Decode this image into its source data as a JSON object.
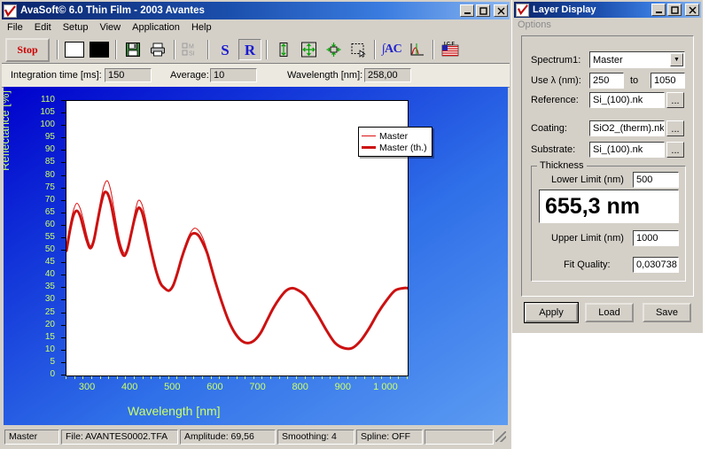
{
  "main_window": {
    "title": "AvaSoft© 6.0 Thin Film - 2003 Avantes",
    "icon": "avasoft-checkmark-icon",
    "buttons": {
      "minimize": "_",
      "maximize": "□",
      "close": "✕"
    },
    "menu": [
      "File",
      "Edit",
      "Setup",
      "View",
      "Application",
      "Help"
    ],
    "toolbar": {
      "stop_label": "Stop",
      "items": [
        {
          "name": "white-reference-button",
          "glyph": ""
        },
        {
          "name": "dark-reference-button",
          "glyph": ""
        },
        {
          "name": "save-button",
          "glyph": ""
        },
        {
          "name": "print-button",
          "glyph": ""
        },
        {
          "name": "multi-si-button",
          "glyph": "M\nSI"
        },
        {
          "name": "scope-s-button",
          "glyph": "S"
        },
        {
          "name": "reflectance-r-button",
          "glyph": "R"
        },
        {
          "name": "scale-vertical-button",
          "glyph": ""
        },
        {
          "name": "zoom-fit-button",
          "glyph": ""
        },
        {
          "name": "zoom-out-button",
          "glyph": ""
        },
        {
          "name": "select-region-button",
          "glyph": ""
        },
        {
          "name": "integrate-ac-button",
          "glyph": "∫AC"
        },
        {
          "name": "peak-graph-button",
          "glyph": ""
        },
        {
          "name": "icf-button",
          "glyph": "I.C.F"
        }
      ]
    },
    "params": {
      "integration_time_label": "Integration time [ms]:",
      "integration_time_value": "150",
      "average_label": "Average:",
      "average_value": "10",
      "wavelength_label": "Wavelength [nm]:",
      "wavelength_value": "258,00"
    },
    "statusbar": {
      "spectrum": "Master",
      "file": "File: AVANTES0002.TFA",
      "amplitude": "Amplitude: 69,56",
      "smoothing": "Smoothing: 4",
      "spline": "Spline: OFF",
      "empty": ""
    }
  },
  "chart_data": {
    "type": "line",
    "title": "",
    "xlabel": "Wavelength [nm]",
    "ylabel": "Reflectance [%]",
    "xlim": [
      250,
      1050
    ],
    "ylim": [
      0,
      110
    ],
    "xticks": [
      300,
      400,
      500,
      600,
      700,
      800,
      900,
      1000
    ],
    "xticklabels": [
      "300",
      "400",
      "500",
      "600",
      "700",
      "800",
      "900",
      "1 000"
    ],
    "yticks": [
      0,
      5,
      10,
      15,
      20,
      25,
      30,
      35,
      40,
      45,
      50,
      55,
      60,
      65,
      70,
      75,
      80,
      85,
      90,
      95,
      100,
      105,
      110
    ],
    "grid": false,
    "legend_position": "outside-right-top",
    "background": "#ffffff",
    "plot_frame_color": "#000000",
    "axis_text_color": "#ccff66",
    "series": [
      {
        "name": "Master",
        "color": "#dd1111",
        "linewidth": 1,
        "x": [
          250,
          258,
          266,
          274,
          282,
          290,
          298,
          306,
          314,
          322,
          330,
          338,
          346,
          354,
          362,
          370,
          378,
          386,
          394,
          402,
          410,
          418,
          426,
          434,
          442,
          450,
          460,
          470,
          480,
          490,
          500,
          510,
          520,
          530,
          540,
          550,
          560,
          570,
          580,
          590,
          600,
          615,
          630,
          645,
          660,
          675,
          690,
          705,
          720,
          735,
          750,
          765,
          780,
          795,
          810,
          825,
          840,
          860,
          880,
          900,
          920,
          940,
          960,
          980,
          1000,
          1020,
          1040,
          1050
        ],
        "y": [
          52,
          60,
          66,
          69,
          67,
          62,
          56,
          52,
          55,
          62,
          70,
          76,
          78,
          74,
          66,
          58,
          52,
          49,
          52,
          58,
          65,
          70,
          69,
          64,
          57,
          50,
          43,
          38,
          35,
          34,
          36,
          41,
          47,
          53,
          57,
          59,
          58,
          55,
          50,
          44,
          38,
          29,
          22,
          17,
          14,
          13,
          14,
          17,
          22,
          27,
          31,
          34,
          35,
          34,
          32,
          28,
          24,
          18,
          13,
          11,
          11,
          14,
          19,
          25,
          30,
          34,
          35,
          35
        ]
      },
      {
        "name": "Master (th.)",
        "color": "#cc1111",
        "linewidth": 3,
        "x": [
          250,
          258,
          266,
          274,
          282,
          290,
          298,
          306,
          314,
          322,
          330,
          338,
          346,
          354,
          362,
          370,
          378,
          386,
          394,
          402,
          410,
          418,
          426,
          434,
          442,
          450,
          460,
          470,
          480,
          490,
          500,
          510,
          520,
          530,
          540,
          550,
          560,
          570,
          580,
          590,
          600,
          615,
          630,
          645,
          660,
          675,
          690,
          705,
          720,
          735,
          750,
          765,
          780,
          795,
          810,
          825,
          840,
          860,
          880,
          900,
          920,
          940,
          960,
          980,
          1000,
          1020,
          1040,
          1050
        ],
        "y": [
          50,
          58,
          64,
          66,
          64,
          59,
          54,
          51,
          54,
          61,
          68,
          73,
          73,
          69,
          62,
          55,
          50,
          48,
          51,
          57,
          63,
          67,
          66,
          61,
          55,
          49,
          42,
          37,
          35,
          34,
          36,
          41,
          47,
          52,
          56,
          57,
          56,
          53,
          49,
          43,
          37,
          29,
          22,
          17,
          14,
          13,
          14,
          17,
          22,
          27,
          31,
          34,
          35,
          34,
          32,
          28,
          24,
          18,
          13,
          11,
          11,
          14,
          19,
          25,
          30,
          34,
          35,
          35
        ]
      }
    ],
    "legend": [
      {
        "label": "Master",
        "color": "#dd1111",
        "linewidth": 1
      },
      {
        "label": "Master (th.)",
        "color": "#cc1111",
        "linewidth": 3
      }
    ]
  },
  "layer_window": {
    "title": "Layer Display",
    "icon": "avasoft-checkmark-icon",
    "buttons": {
      "minimize": "_",
      "maximize": "□",
      "close": "✕"
    },
    "menu": [
      "Options"
    ],
    "fields": {
      "spectrum_label": "Spectrum1:",
      "spectrum_value": "Master",
      "use_lambda_label": "Use λ (nm):",
      "lambda_from": "250",
      "lambda_to_label": "to",
      "lambda_to": "1050",
      "reference_label": "Reference:",
      "reference_value": "Si_(100).nk",
      "coating_label": "Coating:",
      "coating_value": "SiO2_(therm).nk",
      "substrate_label": "Substrate:",
      "substrate_value": "Si_(100).nk",
      "browse_label": "..."
    },
    "thickness": {
      "group_label": "Thickness",
      "lower_limit_label": "Lower Limit (nm)",
      "lower_limit_value": "500",
      "result_value": "655,3 nm",
      "upper_limit_label": "Upper Limit (nm)",
      "upper_limit_value": "1000",
      "fit_quality_label": "Fit Quality:",
      "fit_quality_value": "0,030738"
    },
    "buttons_row": {
      "apply": "Apply",
      "load": "Load",
      "save": "Save"
    }
  }
}
